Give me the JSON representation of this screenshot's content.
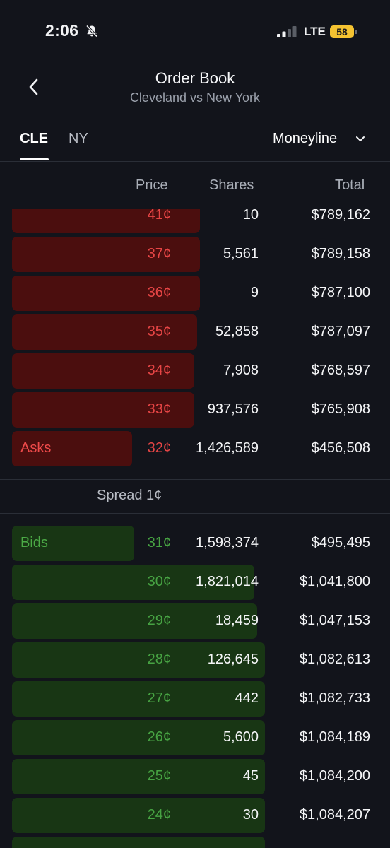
{
  "status_bar": {
    "time": "2:06",
    "network": "LTE",
    "battery": "58"
  },
  "header": {
    "title": "Order Book",
    "subtitle": "Cleveland vs New York"
  },
  "tabs": [
    {
      "label": "CLE",
      "active": true
    },
    {
      "label": "NY",
      "active": false
    }
  ],
  "market_select": {
    "value": "Moneyline"
  },
  "columns": {
    "price": "Price",
    "shares": "Shares",
    "total": "Total"
  },
  "asks_label": "Asks",
  "bids_label": "Bids",
  "spread_label": "Spread 1¢",
  "asks": [
    {
      "price": "41¢",
      "shares": "10",
      "total": "$789,162",
      "depth": 0.72
    },
    {
      "price": "37¢",
      "shares": "5,561",
      "total": "$789,158",
      "depth": 0.72
    },
    {
      "price": "36¢",
      "shares": "9",
      "total": "$787,100",
      "depth": 0.72
    },
    {
      "price": "35¢",
      "shares": "52,858",
      "total": "$787,097",
      "depth": 0.71
    },
    {
      "price": "34¢",
      "shares": "7,908",
      "total": "$768,597",
      "depth": 0.7
    },
    {
      "price": "33¢",
      "shares": "937,576",
      "total": "$765,908",
      "depth": 0.7
    },
    {
      "price": "32¢",
      "shares": "1,426,589",
      "total": "$456,508",
      "depth": 0.46
    }
  ],
  "bids": [
    {
      "price": "31¢",
      "shares": "1,598,374",
      "total": "$495,495",
      "depth": 0.47
    },
    {
      "price": "30¢",
      "shares": "1,821,014",
      "total": "$1,041,800",
      "depth": 0.93
    },
    {
      "price": "29¢",
      "shares": "18,459",
      "total": "$1,047,153",
      "depth": 0.94
    },
    {
      "price": "28¢",
      "shares": "126,645",
      "total": "$1,082,613",
      "depth": 0.97
    },
    {
      "price": "27¢",
      "shares": "442",
      "total": "$1,082,733",
      "depth": 0.97
    },
    {
      "price": "26¢",
      "shares": "5,600",
      "total": "$1,084,189",
      "depth": 0.97
    },
    {
      "price": "25¢",
      "shares": "45",
      "total": "$1,084,200",
      "depth": 0.97
    },
    {
      "price": "24¢",
      "shares": "30",
      "total": "$1,084,207",
      "depth": 0.97
    },
    {
      "price": "",
      "shares": "",
      "total": "",
      "depth": 0.97
    }
  ],
  "colors": {
    "ask_bar": "#4b0e0e",
    "ask_text": "#e64545",
    "bid_bar": "#183614",
    "bid_text": "#47a343",
    "background": "#12141b"
  },
  "icons": {
    "back": "chevron-left-icon",
    "dropdown": "chevron-down-icon",
    "silent": "bell-slash-icon",
    "signal": "cell-signal-icon",
    "battery": "battery-icon"
  }
}
